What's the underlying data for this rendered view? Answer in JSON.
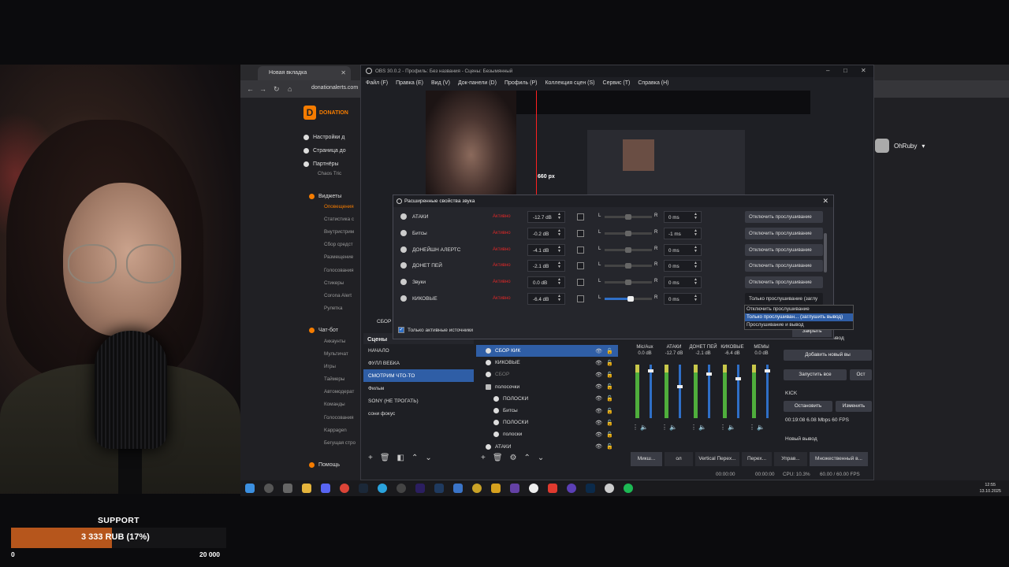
{
  "browser": {
    "tab_label": "Новая вкладка",
    "url": "donationalerts.com",
    "user_name": "OhRuby",
    "sidebar": {
      "brand": "DONATION",
      "top_items": [
        "Настройки д",
        "Страница до",
        "Партнёры"
      ],
      "chaos": "Chaos Tric",
      "widgets_head": "Виджеты",
      "widget_items": [
        "Оповещения",
        "Статистика с",
        "Внутристрим",
        "Сбор средст",
        "Размещение",
        "Голосования",
        "Стикеры",
        "Corona Alert",
        "Рулетка"
      ],
      "chatbot_head": "Чат-бот",
      "chatbot_items": [
        "Аккаунты",
        "Мультичат",
        "Игры",
        "Таймеры",
        "Автомодерат",
        "Команды",
        "Голосования",
        "Kappagen",
        "Бегущая стро"
      ],
      "help": "Помощь"
    }
  },
  "obs": {
    "title": "OBS 30.0.2 - Профиль: Без названия - Сцены: Безымянный",
    "menu": [
      "Файл (F)",
      "Правка (E)",
      "Вид (V)",
      "Док-панели (D)",
      "Профиль (P)",
      "Коллекция сцен (S)",
      "Сервис (T)",
      "Справка (H)"
    ],
    "preview_label": "660 px",
    "source_label_partial": "СБОР",
    "scenes_title": "Сцены",
    "scenes": [
      "НАЧАЛО",
      "ФУЛЛ ВЕБКА",
      "СМОТРИМ ЧТО-ТО",
      "Фильм",
      "SONY (НЕ ТРОГАТЬ)",
      "сони фокус"
    ],
    "selected_scene": 2,
    "sources": [
      {
        "name": "СБОР КИК",
        "indent": 0,
        "state": "selected"
      },
      {
        "name": "КИКОВЫЕ",
        "indent": 0,
        "state": "normal"
      },
      {
        "name": "СБОР",
        "indent": 0,
        "state": "dim"
      },
      {
        "name": "полосочки",
        "indent": 0,
        "state": "group"
      },
      {
        "name": "ПОЛОСКИ",
        "indent": 1,
        "state": "normal"
      },
      {
        "name": "Битсы",
        "indent": 1,
        "state": "normal"
      },
      {
        "name": "ПОЛОСКИ",
        "indent": 1,
        "state": "normal"
      },
      {
        "name": "полоски",
        "indent": 1,
        "state": "normal"
      },
      {
        "name": "АТАКИ",
        "indent": 0,
        "state": "normal"
      }
    ],
    "mixer": [
      {
        "name": "Mic/Aux",
        "db": "0.0 dB",
        "fader": 0.9
      },
      {
        "name": "АТАКИ",
        "db": "-12.7 dB",
        "fader": 0.6
      },
      {
        "name": "ДОНЕТ ПЕЙ",
        "db": "-2.1 dB",
        "fader": 0.85
      },
      {
        "name": "КИКОВЫЕ",
        "db": "-6.4 dB",
        "fader": 0.75
      },
      {
        "name": "МЕМЫ",
        "db": "0.0 dB",
        "fader": 0.9
      }
    ],
    "controls": {
      "header": "вывод",
      "add_output": "Добавить новый вы",
      "start_all": "Запустить все",
      "start_partial": "Ост",
      "service": "KICK",
      "stop": "Остановить",
      "edit": "Изменить",
      "stats": "00:19:08  6.08 Mbps  60 FPS",
      "new_output": "Новый вывод"
    },
    "bottom_tabs": [
      "Микш...",
      "ол",
      "Vertical Переx...",
      "Перех...",
      "Управ...",
      "Множественный в..."
    ],
    "status": {
      "time1": "00:00:00",
      "time2": "00:00:00",
      "cpu": "CPU: 10.3%",
      "fps": "60.00 / 60.00 FPS"
    }
  },
  "dialog": {
    "title": "Расширенные свойства звука",
    "active_label": "Активно",
    "rows": [
      {
        "name": "АТАКИ",
        "volume": "-12.7 dB",
        "sync": "0 ms",
        "monitor": "Отключить прослушивание",
        "balance": 0.5
      },
      {
        "name": "Битсы",
        "volume": "-0.2 dB",
        "sync": "-1 ms",
        "monitor": "Отключить прослушивание",
        "balance": 0.5
      },
      {
        "name": "ДОНЕЙШН АЛЕРТС",
        "volume": "-4.1 dB",
        "sync": "0 ms",
        "monitor": "Отключить прослушивание",
        "balance": 0.5
      },
      {
        "name": "ДОНЕТ ПЕЙ",
        "volume": "-2.1 dB",
        "sync": "0 ms",
        "monitor": "Отключить прослушивание",
        "balance": 0.5
      },
      {
        "name": "Звуки",
        "volume": "0.0 dB",
        "sync": "0 ms",
        "monitor": "Отключить прослушивание",
        "balance": 0.5
      },
      {
        "name": "КИКОВЫЕ",
        "volume": "-6.4 dB",
        "sync": "0 ms",
        "monitor": "Только прослушивание (заглу",
        "balance": 0.55
      }
    ],
    "balance_left": "L",
    "balance_right": "R",
    "only_active": "Только активные источники",
    "close": "Закрыть",
    "popup_options": [
      "Отключить прослушивание",
      "Только прослушиван... (заглушить вывод)",
      "Прослушивание и вывод"
    ],
    "popup_selected": 1
  },
  "taskbar": {
    "time": "12:55",
    "date": "13.10.2025"
  },
  "widget": {
    "title": "SUPPORT",
    "amount": "3 333 RUB (17%)",
    "min": "0",
    "max": "20 000",
    "progress": 0.17,
    "fill_color": "#b6561c"
  }
}
